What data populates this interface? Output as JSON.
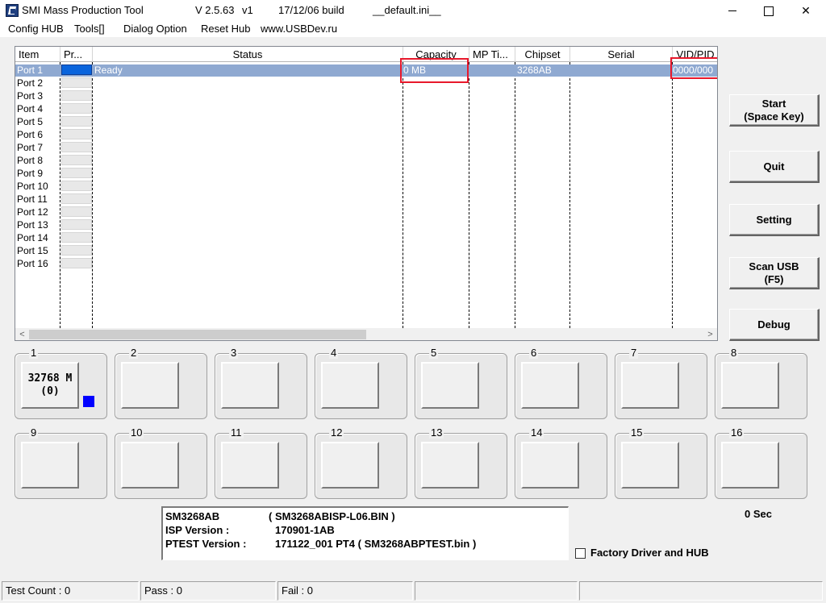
{
  "window": {
    "app_name": "SMI Mass Production Tool",
    "version_label": "V 2.5.63",
    "version_num": "v1",
    "build": "17/12/06 build",
    "ini_file": "__default.ini__",
    "minimize": "",
    "maximize": "",
    "close": "✕"
  },
  "menu": [
    "Config HUB",
    "Tools[]",
    "Dialog Option",
    "Reset Hub",
    "www.USBDev.ru"
  ],
  "list": {
    "columns": [
      "Item",
      "Pr...",
      "Status",
      "Capacity",
      "MP Ti...",
      "Chipset",
      "Serial",
      "VID/PID"
    ],
    "ports": [
      "Port 1",
      "Port 2",
      "Port 3",
      "Port 4",
      "Port 5",
      "Port 6",
      "Port 7",
      "Port 8",
      "Port 9",
      "Port 10",
      "Port 11",
      "Port 12",
      "Port 13",
      "Port 14",
      "Port 15",
      "Port 16"
    ],
    "row1": {
      "status": "Ready",
      "capacity": "0 MB",
      "chipset": "3268AB",
      "vidpid": "0000/000"
    },
    "scroll_left": "<",
    "scroll_right": ">"
  },
  "buttons": {
    "start": "Start\n(Space Key)",
    "quit": "Quit",
    "setting": "Setting",
    "scan": "Scan USB\n(F5)",
    "debug": "Debug"
  },
  "panels": {
    "numbers": [
      "1",
      "2",
      "3",
      "4",
      "5",
      "6",
      "7",
      "8",
      "9",
      "10",
      "11",
      "12",
      "13",
      "14",
      "15",
      "16"
    ],
    "port1_text": "32768 M\n(0)"
  },
  "info": {
    "chip": "SM3268AB",
    "isp_file": "( SM3268ABISP-L06.BIN )",
    "isp_label": "ISP Version :",
    "isp_version": "170901-1AB",
    "ptest_label": "PTEST Version :",
    "ptest_version": "171122_001   PT4 ( SM3268ABPTEST.bin )"
  },
  "timer": "0 Sec",
  "factory_checkbox": "Factory Driver and HUB",
  "status": {
    "test_count": "Test Count : 0",
    "pass": "Pass : 0",
    "fail": "Fail : 0"
  }
}
